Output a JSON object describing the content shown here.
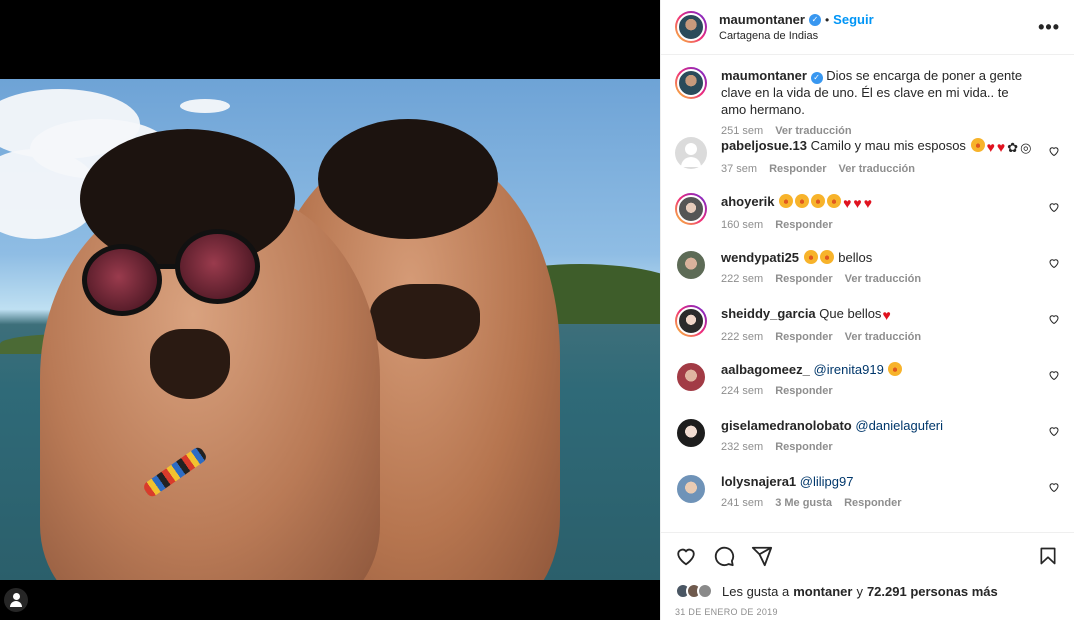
{
  "header": {
    "username": "maumontaner",
    "follow_label": "Seguir",
    "separator": "•",
    "location": "Cartagena de Indias",
    "more_label": "•••"
  },
  "caption": {
    "username": "maumontaner",
    "text": "Dios se encarga de poner a gente clave en la vida de uno. Él es clave en mi vida.. te amo hermano.",
    "time": "251 sem",
    "translate": "Ver traducción"
  },
  "comments": [
    {
      "username": "pabeljosue.13",
      "text": "Camilo y mau mis esposos",
      "time": "37 sem",
      "reply": "Responder",
      "translate": "Ver traducción"
    },
    {
      "username": "ahoyerik",
      "text": "",
      "time": "160 sem",
      "reply": "Responder"
    },
    {
      "username": "wendypati25",
      "text": "bellos",
      "time": "222 sem",
      "reply": "Responder",
      "translate": "Ver traducción"
    },
    {
      "username": "sheiddy_garcia",
      "text": "Que bellos",
      "time": "222 sem",
      "reply": "Responder",
      "translate": "Ver traducción"
    },
    {
      "username": "aalbagomeez_",
      "mention": "@irenita919",
      "time": "224 sem",
      "reply": "Responder"
    },
    {
      "username": "giselamedranolobato",
      "mention": "@danielaguferi",
      "time": "232 sem",
      "reply": "Responder"
    },
    {
      "username": "lolysnajera1",
      "mention": "@lilipg97",
      "time": "241 sem",
      "likes": "3 Me gusta",
      "reply": "Responder"
    }
  ],
  "likes": {
    "prefix": "Les gusta a",
    "user": "montaner",
    "connector": "y",
    "count": "72.291 personas más"
  },
  "date": "31 DE ENERO DE 2019",
  "icons": [
    "heart-icon",
    "comment-icon",
    "share-icon",
    "bookmark-icon",
    "verified-icon",
    "user-tag-icon"
  ]
}
